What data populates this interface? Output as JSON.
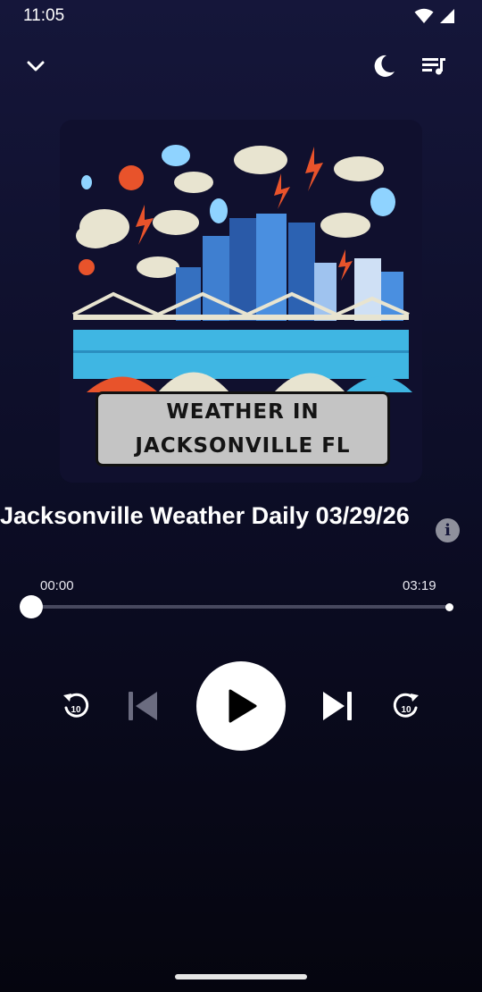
{
  "status_bar": {
    "time": "11:05"
  },
  "artwork": {
    "title_line1": "WEATHER IN",
    "title_line2": "JACKSONVILLE FL"
  },
  "episode": {
    "title": "Jacksonville Weather Daily 03/29/26"
  },
  "player": {
    "elapsed": "00:00",
    "duration": "03:19",
    "progress_fraction": 0.0,
    "skip_seconds": "10"
  },
  "colors": {
    "background_top": "#15163a",
    "background_bottom": "#05050f",
    "accent": "#ffffff",
    "track": "#47485e"
  }
}
